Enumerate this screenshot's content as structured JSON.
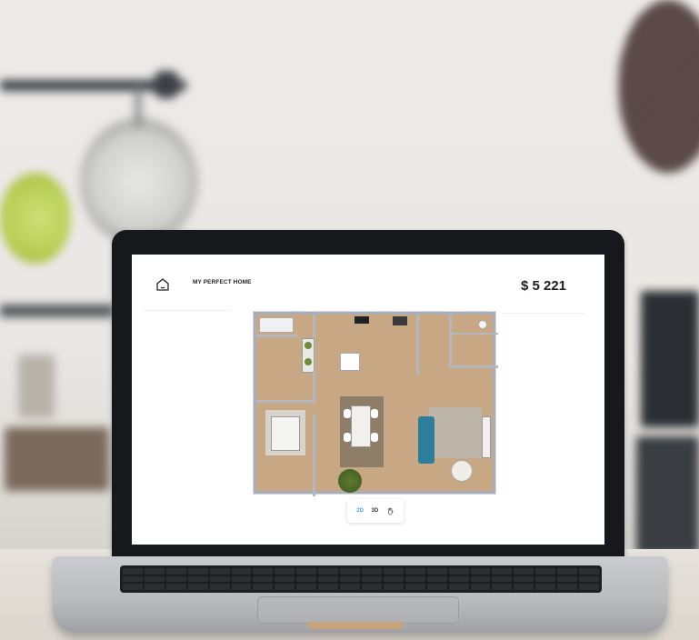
{
  "app": {
    "title": "MY PERFECT HOME",
    "price": "$ 5 221"
  },
  "view_toggle": {
    "options": [
      {
        "label": "2D",
        "active": true
      },
      {
        "label": "3D",
        "active": false
      }
    ],
    "extra_icon": "hand-icon"
  },
  "icons": {
    "home": "home-icon",
    "pan": "hand-icon"
  },
  "colors": {
    "accent": "#3aa8d8",
    "floor": "#c8a884",
    "wall": "#b3b8bf",
    "sofa": "#2f7e9c",
    "laptop_bezel": "#16181b"
  }
}
